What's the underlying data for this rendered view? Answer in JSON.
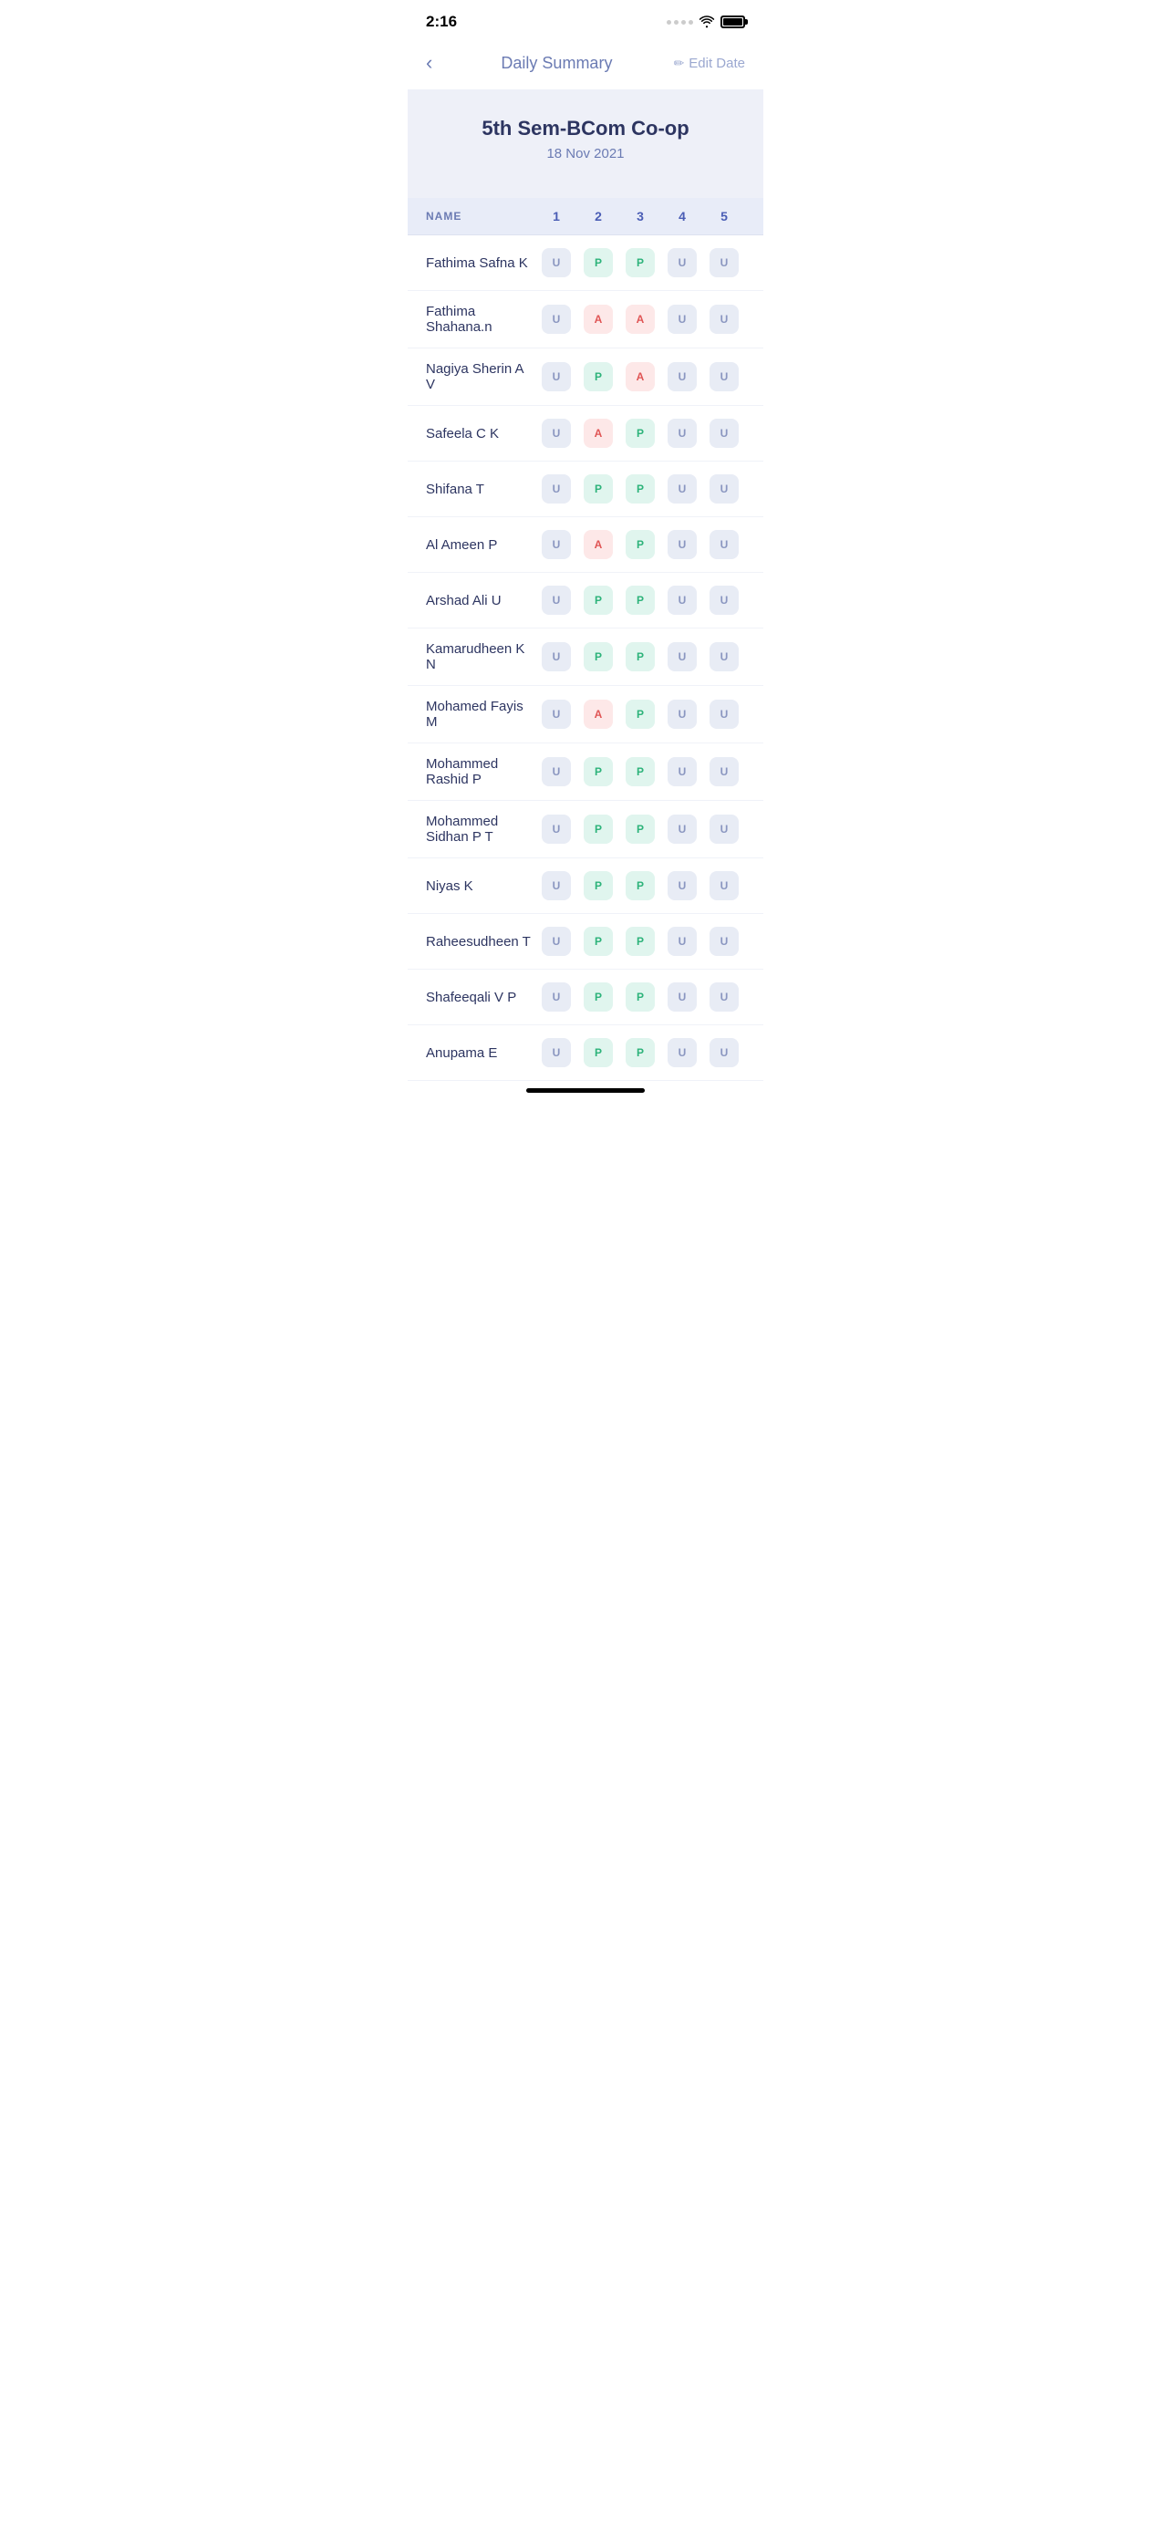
{
  "statusBar": {
    "time": "2:16"
  },
  "nav": {
    "backLabel": "<",
    "title": "Daily Summary",
    "editLabel": "Edit Date",
    "pencilSymbol": "✏"
  },
  "header": {
    "classTitle": "5th Sem-BCom Co-op",
    "date": "18 Nov 2021"
  },
  "table": {
    "columns": {
      "nameLabel": "NAME",
      "periods": [
        "1",
        "2",
        "3",
        "4",
        "5"
      ]
    },
    "students": [
      {
        "name": "Fathima Safna K",
        "p1": "U",
        "p2": "P",
        "p3": "P",
        "p4": "U",
        "p5": "U"
      },
      {
        "name": "Fathima Shahana.n",
        "p1": "U",
        "p2": "A",
        "p3": "A",
        "p4": "U",
        "p5": "U"
      },
      {
        "name": "Nagiya Sherin A V",
        "p1": "U",
        "p2": "P",
        "p3": "A",
        "p4": "U",
        "p5": "U"
      },
      {
        "name": "Safeela C K",
        "p1": "U",
        "p2": "A",
        "p3": "P",
        "p4": "U",
        "p5": "U"
      },
      {
        "name": "Shifana T",
        "p1": "U",
        "p2": "P",
        "p3": "P",
        "p4": "U",
        "p5": "U"
      },
      {
        "name": "Al Ameen P",
        "p1": "U",
        "p2": "A",
        "p3": "P",
        "p4": "U",
        "p5": "U"
      },
      {
        "name": "Arshad Ali U",
        "p1": "U",
        "p2": "P",
        "p3": "P",
        "p4": "U",
        "p5": "U"
      },
      {
        "name": "Kamarudheen K N",
        "p1": "U",
        "p2": "P",
        "p3": "P",
        "p4": "U",
        "p5": "U"
      },
      {
        "name": "Mohamed Fayis M",
        "p1": "U",
        "p2": "A",
        "p3": "P",
        "p4": "U",
        "p5": "U"
      },
      {
        "name": "Mohammed Rashid P",
        "p1": "U",
        "p2": "P",
        "p3": "P",
        "p4": "U",
        "p5": "U"
      },
      {
        "name": "Mohammed Sidhan P T",
        "p1": "U",
        "p2": "P",
        "p3": "P",
        "p4": "U",
        "p5": "U"
      },
      {
        "name": "Niyas K",
        "p1": "U",
        "p2": "P",
        "p3": "P",
        "p4": "U",
        "p5": "U"
      },
      {
        "name": "Raheesudheen T",
        "p1": "U",
        "p2": "P",
        "p3": "P",
        "p4": "U",
        "p5": "U"
      },
      {
        "name": "Shafeeqali V P",
        "p1": "U",
        "p2": "P",
        "p3": "P",
        "p4": "U",
        "p5": "U"
      },
      {
        "name": "Anupama E",
        "p1": "U",
        "p2": "P",
        "p3": "P",
        "p4": "U",
        "p5": "U"
      }
    ]
  }
}
